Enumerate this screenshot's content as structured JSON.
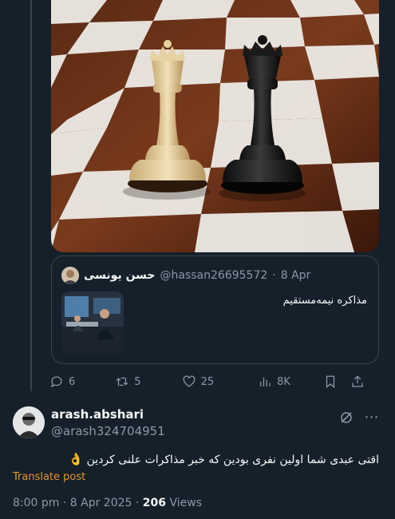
{
  "quoted_tweet": {
    "author_name": "حسن یونسی",
    "author_handle": "@hassan26695572",
    "date": "8 Apr",
    "text": "مذاکره نیمه‌مستقیم"
  },
  "actions": {
    "replies": "6",
    "reposts": "5",
    "likes": "25",
    "views": "8K"
  },
  "reply_tweet": {
    "author_name": "arash.abshari",
    "author_handle": "@arash324704951",
    "text": "اقتی عبدی شما اولین نفری بودین که خبر مذاکرات علنی کردین",
    "emoji": "👌",
    "translate_label": "Translate post",
    "timestamp": "8:00 pm · 8 Apr 2025 · ",
    "view_count": "206",
    "views_label": " Views"
  },
  "colors": {
    "background": "#15202b",
    "text_secondary": "#8b98a5",
    "border": "#38444d",
    "translate": "#e8952a"
  }
}
